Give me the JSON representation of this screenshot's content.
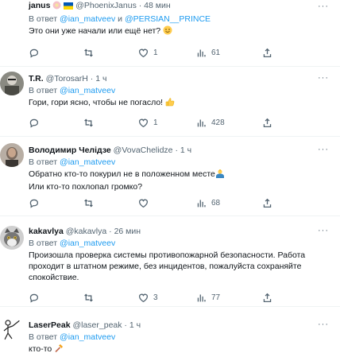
{
  "tweets": [
    {
      "name": "janus",
      "handle": "@PhoenixJanus",
      "dot": "·",
      "time": "48 мин",
      "reply_prefix": "В ответ",
      "reply_to_1": "@ian_matveev",
      "reply_and": "и",
      "reply_to_2": "@PERSIAN__PRINCE",
      "text": "Это они уже начали или ещё нет?",
      "reply_count": "",
      "retweet_count": "",
      "like_count": "1",
      "view_count": "61"
    },
    {
      "name": "T.R.",
      "handle": "@TorosarH",
      "dot": "·",
      "time": "1 ч",
      "reply_prefix": "В ответ",
      "reply_to_1": "@ian_matveev",
      "text": "Гори, гори ясно, чтобы не погасло!",
      "reply_count": "",
      "retweet_count": "",
      "like_count": "1",
      "view_count": "428"
    },
    {
      "name": "Володимир Челідзе",
      "handle": "@VovaChelidze",
      "dot": "·",
      "time": "1 ч",
      "reply_prefix": "В ответ",
      "reply_to_1": "@ian_matveev",
      "text_line1": "Обратно кто-то покурил не в положенном месте",
      "text_line2": "Или кто-то похлопал громко?",
      "reply_count": "",
      "retweet_count": "",
      "like_count": "",
      "view_count": "68"
    },
    {
      "name": "kakavlya",
      "handle": "@kakavlya",
      "dot": "·",
      "time": "26 мин",
      "reply_prefix": "В ответ",
      "reply_to_1": "@ian_matveev",
      "text_line1": "Произошла проверка системы противопожарной безопасности. Работа",
      "text_line2": "проходит в штатном режиме, без инцидентов, пожалуйста сохраняйте",
      "text_line3": "спокойствие.",
      "reply_count": "",
      "retweet_count": "",
      "like_count": "3",
      "view_count": "77"
    },
    {
      "name": "LaserPeak",
      "handle": "@laser_peak",
      "dot": "·",
      "time": "1 ч",
      "reply_prefix": "В ответ",
      "reply_to_1": "@ian_matveev",
      "text": "кто-то"
    }
  ],
  "more_glyph": "···",
  "colors": {
    "link": "#1d9bf0",
    "secondary": "#536471",
    "text": "#0f1419",
    "divider": "#eff3f4"
  }
}
